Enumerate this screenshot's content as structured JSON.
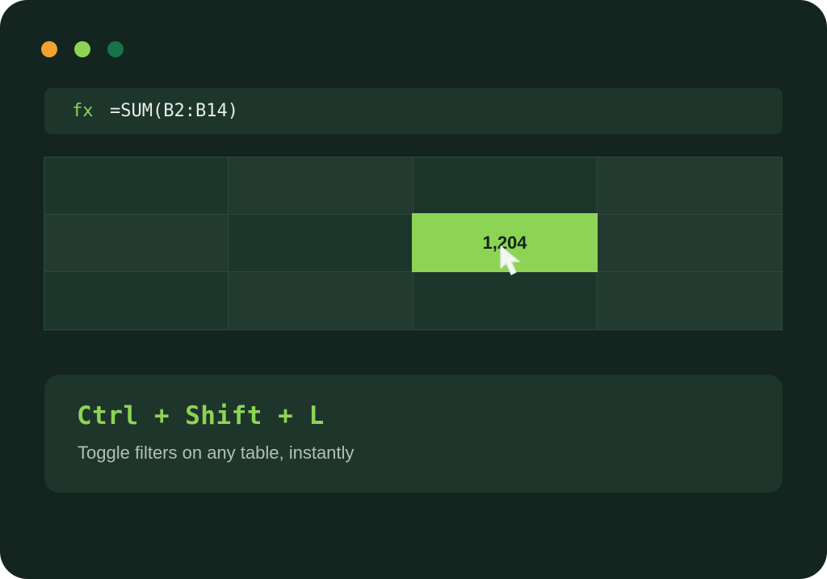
{
  "colors": {
    "window_bg": "#13251e",
    "panel_bg": "#1e352c",
    "accent_green": "#8dd454",
    "traffic_light_orange": "#f2a230",
    "traffic_light_lime": "#8dd454",
    "traffic_light_dark_green": "#17724a"
  },
  "window_controls": {
    "buttons": [
      "orange-dot",
      "lime-dot",
      "green-dot"
    ]
  },
  "formula_bar": {
    "fx_label": "fx",
    "formula": "=SUM(B2:B14)"
  },
  "spreadsheet": {
    "rows": 3,
    "columns": 4,
    "active_cell": {
      "row": 2,
      "column": 3,
      "value": "1,204"
    },
    "cursor_icon": "mouse-pointer-icon"
  },
  "tip": {
    "shortcut": "Ctrl + Shift + L",
    "description": "Toggle filters on any table, instantly"
  }
}
